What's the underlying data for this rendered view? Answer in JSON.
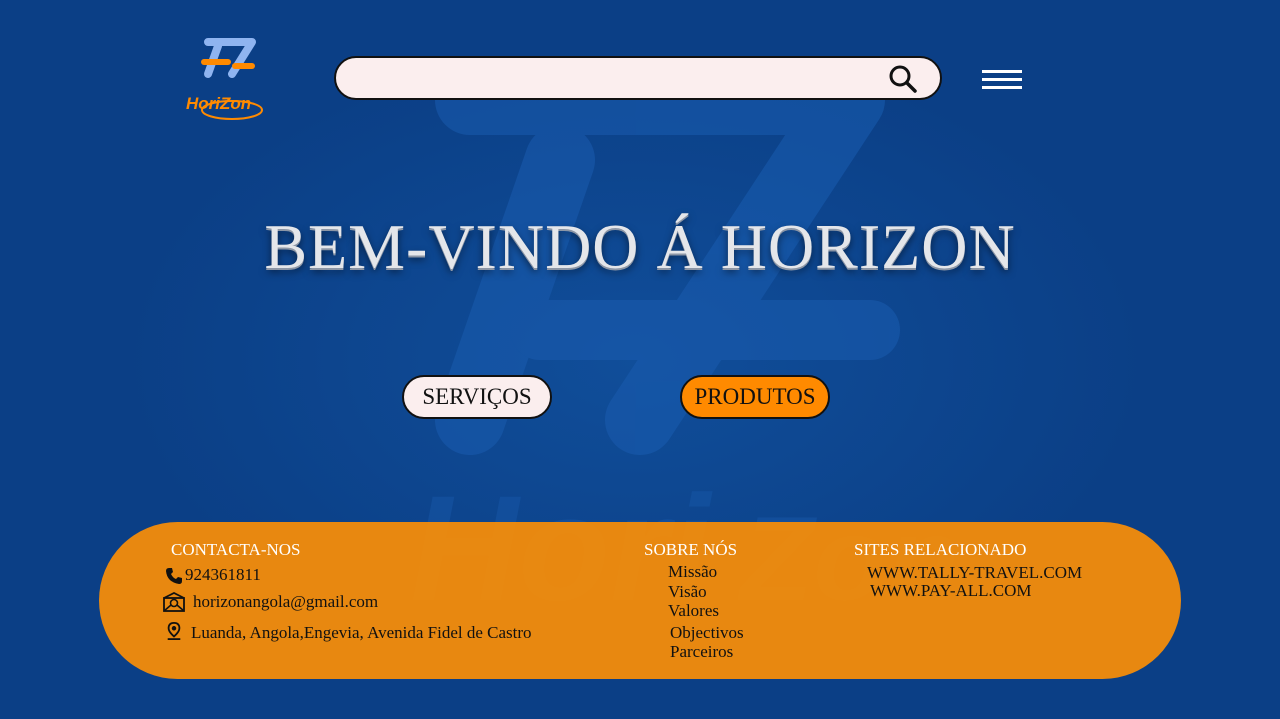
{
  "header": {
    "logo_text": "HoriZon",
    "search": {
      "value": "",
      "placeholder": ""
    },
    "icons": {
      "search": "search-icon",
      "menu": "hamburger-menu-icon"
    }
  },
  "hero": {
    "title": "BEM-VINDO Á HORIZON"
  },
  "actions": {
    "servicos": "SERVIÇOS",
    "produtos": "PRODUTOS"
  },
  "footer": {
    "contact": {
      "title": "CONTACTA-NOS",
      "phone": "924361811",
      "email": "horizonangola@gmail.com",
      "address": "Luanda, Angola,Engevia, Avenida Fidel de Castro"
    },
    "about": {
      "title": "SOBRE NÓS",
      "items": [
        "Missão",
        "Visão",
        "Valores",
        "Objectivos",
        "Parceiros"
      ]
    },
    "sites": {
      "title": "SITES RELACIONADO",
      "items": [
        "WWW.TALLY-TRAVEL.COM",
        "WWW.PAY-ALL.COM"
      ]
    }
  },
  "colors": {
    "background": "#0b3f86",
    "accent_orange": "#ff8a00",
    "footer_orange": "#f48c0a",
    "light_pill": "#fbeeee"
  }
}
